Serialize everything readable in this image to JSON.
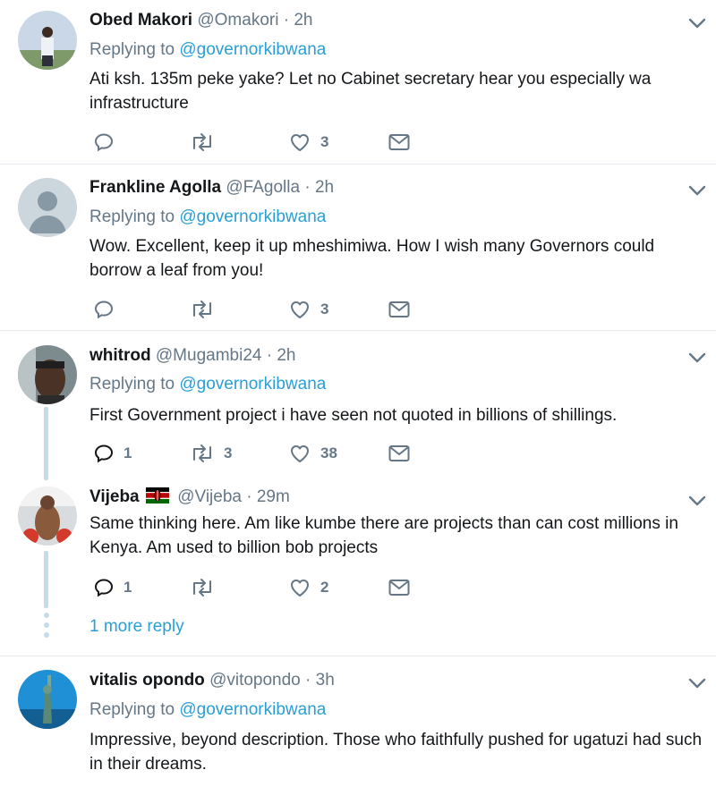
{
  "tweets": [
    {
      "name": "Obed Makori",
      "handle": "@Omakori",
      "time": "2h",
      "replying_prefix": "Replying to",
      "replying_to": "@governorkibwana",
      "text": "Ati ksh. 135m peke yake? Let no Cabinet secretary hear you especially wa infrastructure",
      "replies": "",
      "retweets": "",
      "likes": "3"
    },
    {
      "name": "Frankline Agolla",
      "handle": "@FAgolla",
      "time": "2h",
      "replying_prefix": "Replying to",
      "replying_to": "@governorkibwana",
      "text": "Wow. Excellent, keep it up mheshimiwa. How I wish many Governors could borrow a leaf from you!",
      "replies": "",
      "retweets": "",
      "likes": "3"
    },
    {
      "name": "whitrod",
      "handle": "@Mugambi24",
      "time": "2h",
      "replying_prefix": "Replying to",
      "replying_to": "@governorkibwana",
      "text": "First Government project i have seen not quoted in billions of shillings.",
      "replies": "1",
      "retweets": "3",
      "likes": "38"
    },
    {
      "name": "Vijeba",
      "handle": "@Vijeba",
      "time": "29m",
      "text": "Same thinking here. Am like kumbe there are projects than can cost millions in Kenya. Am used to billion bob projects",
      "replies": "1",
      "retweets": "",
      "likes": "2"
    },
    {
      "name": "vitalis opondo",
      "handle": "@vitopondo",
      "time": "3h",
      "replying_prefix": "Replying to",
      "replying_to": "@governorkibwana",
      "text": "Impressive, beyond description. Those who faithfully pushed for ugatuzi had such in their dreams."
    }
  ],
  "more_replies": "1 more reply",
  "dot": "·",
  "colors": {
    "link": "#2a9fd6",
    "muted": "#657786",
    "thread": "#c4dbe8"
  },
  "icons": [
    "reply-icon",
    "retweet-icon",
    "heart-icon",
    "dm-icon",
    "chevron-down-icon",
    "kenya-flag-icon"
  ]
}
